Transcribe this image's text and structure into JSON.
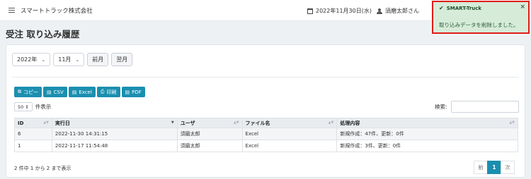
{
  "topbar": {
    "company": "スマートトラック株式会社",
    "date": "2022年11月30日(水)",
    "user": "須磨太郎さん"
  },
  "page": {
    "title": "受注 取り込み履歴"
  },
  "filters": {
    "year": "2022年",
    "month": "11月",
    "prev_label": "前月",
    "next_label": "翌月"
  },
  "export": {
    "copy": "コピー",
    "csv": "CSV",
    "excel": "Excel",
    "print": "印刷",
    "pdf": "PDF"
  },
  "length": {
    "value": "50",
    "label": "件表示"
  },
  "search": {
    "label": "検索:",
    "value": ""
  },
  "table": {
    "headers": [
      "ID",
      "実行日",
      "ユーザ",
      "ファイル名",
      "処理内容"
    ],
    "rows": [
      [
        "6",
        "2022-11-30 14:31:15",
        "須磨太郎",
        "Excel",
        "新規作成：47件、更新：0件"
      ],
      [
        "1",
        "2022-11-17 11:54:48",
        "須磨太郎",
        "Excel",
        "新規作成：3件、更新：0件"
      ]
    ]
  },
  "footer": {
    "info": "2 件中 1 から 2 まで表示",
    "prev": "前",
    "page": "1",
    "next": "次"
  },
  "toast": {
    "title": "SMART-Truck",
    "message": "取り込みデータを削除しました。",
    "close": "×"
  },
  "colors": {
    "accent": "#1a8fb0",
    "toast_bg": "#d6ecd9",
    "toast_border": "#e21b1b"
  }
}
